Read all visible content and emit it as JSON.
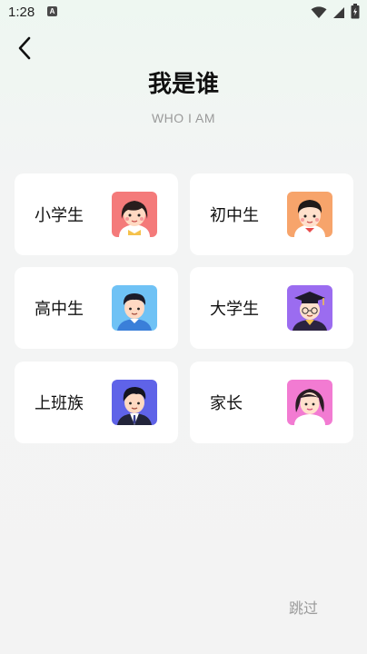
{
  "status_bar": {
    "time": "1:28",
    "notification_letter": "A"
  },
  "header": {
    "title": "我是谁",
    "subtitle": "WHO I AM"
  },
  "roles": [
    {
      "label": "小学生",
      "icon": "girl-student-avatar-icon",
      "color": "#f47a7a"
    },
    {
      "label": "初中生",
      "icon": "middle-school-girl-avatar-icon",
      "color": "#f7a46b"
    },
    {
      "label": "高中生",
      "icon": "high-school-boy-avatar-icon",
      "color": "#6fc2f5"
    },
    {
      "label": "大学生",
      "icon": "graduate-avatar-icon",
      "color": "#9b6cf0"
    },
    {
      "label": "上班族",
      "icon": "office-worker-avatar-icon",
      "color": "#5f63e8"
    },
    {
      "label": "家长",
      "icon": "parent-avatar-icon",
      "color": "#f27bd2"
    }
  ],
  "skip_label": "跳过"
}
